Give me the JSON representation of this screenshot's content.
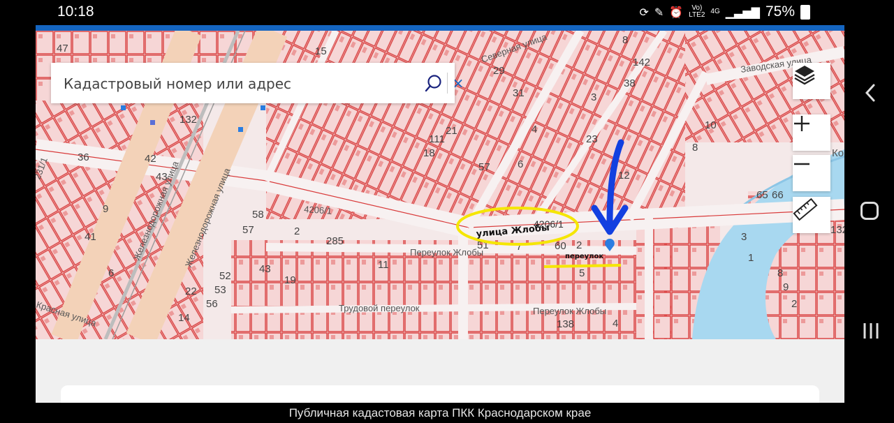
{
  "status_bar": {
    "time": "10:18",
    "network_top": "Vo)",
    "network_bottom": "LTE2",
    "net_type": "4G",
    "battery": "75%"
  },
  "search": {
    "placeholder": "Кадастровый номер или адрес",
    "clear_glyph": "×"
  },
  "map": {
    "parcel_labels": [
      "15",
      "47",
      "29",
      "31",
      "21",
      "111",
      "18",
      "57",
      "6",
      "4",
      "23",
      "3",
      "12",
      "142",
      "38",
      "10",
      "8",
      "8",
      "132",
      "36",
      "42",
      "43",
      "9",
      "6",
      "41",
      "58",
      "57",
      "2",
      "285",
      "43",
      "19",
      "52",
      "53",
      "22",
      "56",
      "14",
      "51",
      "7",
      "60",
      "2",
      "11",
      "5",
      "138",
      "4",
      "65",
      "66",
      "8",
      "9",
      "2",
      "1",
      "3",
      "132"
    ],
    "street_labels": {
      "railroad_1": "Железнодорожная улица",
      "railroad_2": "Железнодорожная улица",
      "severnaya": "Северная улица",
      "zhlobyi_lane": "Переулок Жлобы",
      "trudovoy": "Трудовой переулок",
      "zhlobyi_lane_2": "Переулок Жлобы",
      "zavodskaya": "Заводская улица",
      "krasnaya": "Красная улица",
      "left_number": "231/1",
      "upper_num": "4206/1",
      "ko": "Ко"
    },
    "annotations": {
      "circled_text": "улица Жлобы",
      "circled_number": "4206/1",
      "underline_text": "переулок"
    },
    "colors": {
      "parcel_line": "#d93a3a",
      "parcel_fill": "#f6d6d6",
      "road": "#f7f1f1",
      "water": "#a8d8f0",
      "highlight": "#f5e600",
      "arrow": "#1340e0"
    }
  },
  "controls": {
    "layers": "layers-icon",
    "zoom_in": "+",
    "zoom_out": "−",
    "ruler": "ruler-icon"
  },
  "caption": "Публичная кадастовая карта ПКК Краснодарском крае"
}
